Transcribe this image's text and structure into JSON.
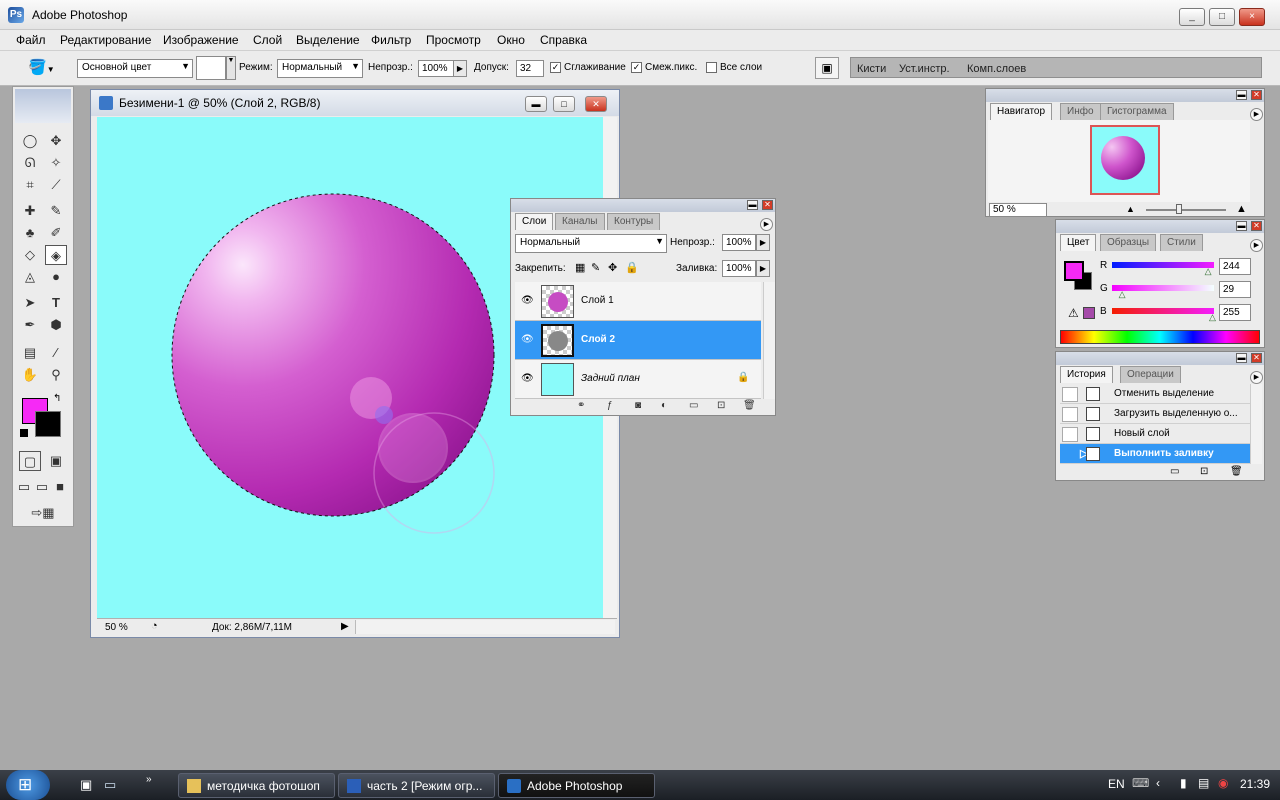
{
  "window": {
    "title": "Adobe Photoshop",
    "min": "_",
    "max": "□",
    "close": "×"
  },
  "menu": [
    "Файл",
    "Редактирование",
    "Изображение",
    "Слой",
    "Выделение",
    "Фильтр",
    "Просмотр",
    "Окно",
    "Справка"
  ],
  "options": {
    "fill_source": "Основной цвет",
    "mode_label": "Режим:",
    "mode_value": "Нормальный",
    "opacity_label": "Непрозр.:",
    "opacity_value": "100%",
    "tolerance_label": "Допуск:",
    "tolerance_value": "32",
    "antialias_label": "Сглаживание",
    "contiguous_label": "Смеж.пикс.",
    "all_layers_label": "Все слои",
    "well_tabs": [
      "Кисти",
      "Уст.инстр.",
      "Комп.слоев"
    ]
  },
  "colors": {
    "foreground": "#f629f6",
    "background": "#000000",
    "canvas": "#8afbfa",
    "selection": "#3398f5"
  },
  "document": {
    "title": "Безимени-1 @ 50% (Слой 2, RGB/8)",
    "zoom": "50 %",
    "doc_info": "Док: 2,86M/7,11M"
  },
  "layers_panel": {
    "tabs": [
      "Слои",
      "Каналы",
      "Контуры"
    ],
    "blend_mode": "Нормальный",
    "opacity_label": "Непрозр.:",
    "opacity_value": "100%",
    "lock_label": "Закрепить:",
    "fill_label": "Заливка:",
    "fill_value": "100%",
    "layers": [
      {
        "name": "Слой 1"
      },
      {
        "name": "Слой 2"
      },
      {
        "name": "Задний план"
      }
    ]
  },
  "navigator_panel": {
    "tabs": [
      "Навигатор",
      "Инфо",
      "Гистограмма"
    ],
    "zoom": "50 %"
  },
  "color_panel": {
    "tabs": [
      "Цвет",
      "Образцы",
      "Стили"
    ],
    "r_label": "R",
    "r_value": "244",
    "r_level": 0.957,
    "g_label": "G",
    "g_value": "29",
    "g_level": 0.114,
    "b_label": "B",
    "b_value": "255",
    "b_level": 1.0
  },
  "history_panel": {
    "tabs": [
      "История",
      "Операции"
    ],
    "items": [
      {
        "label": "Отменить выделение"
      },
      {
        "label": "Загрузить выделенную о..."
      },
      {
        "label": "Новый слой"
      },
      {
        "label": "Выполнить заливку"
      }
    ]
  },
  "taskbar": {
    "buttons": [
      "методичка фотошоп",
      "часть 2 [Режим огр...",
      "Adobe Photoshop"
    ],
    "lang": "EN",
    "clock": "21:39"
  }
}
